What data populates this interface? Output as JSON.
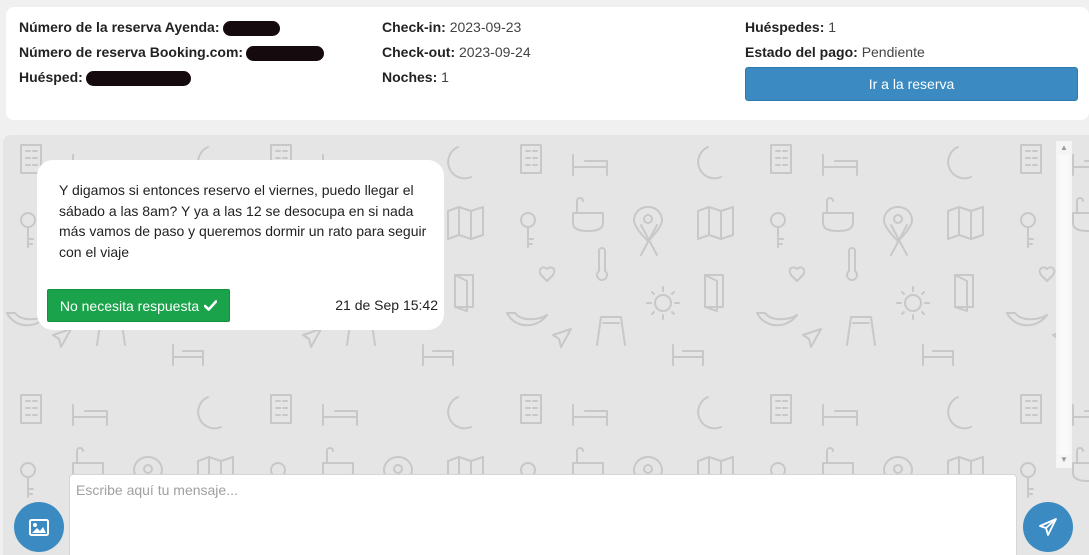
{
  "reservation": {
    "ayenda_label": "Número de la reserva Ayenda:",
    "booking_label": "Número de reserva Booking.com:",
    "guest_label": "Huésped:",
    "checkin_label": "Check-in:",
    "checkin_value": "2023-09-23",
    "checkout_label": "Check-out:",
    "checkout_value": "2023-09-24",
    "nights_label": "Noches:",
    "nights_value": "1",
    "guests_label": "Huéspedes:",
    "guests_value": "1",
    "payment_label": "Estado del pago:",
    "payment_value": "Pendiente",
    "go_button": "Ir a la reserva"
  },
  "chat": {
    "message": {
      "text": "Y digamos si entonces reservo el viernes, puedo llegar el sábado a las 8am? Y ya a las 12 se desocupa en si nada más vamos de paso y queremos dormir un rato para seguir con el viaje",
      "no_reply_button": "No necesita respuesta",
      "timestamp": "21 de Sep 15:42"
    },
    "input_placeholder": "Escribe aquí tu mensaje..."
  },
  "icons": {
    "image_button": "image-icon",
    "send_button": "send-icon",
    "check": "check-icon"
  },
  "colors": {
    "primary": "#3b8bc2",
    "success": "#1aa34a",
    "chat_background": "#e5e5e5"
  }
}
